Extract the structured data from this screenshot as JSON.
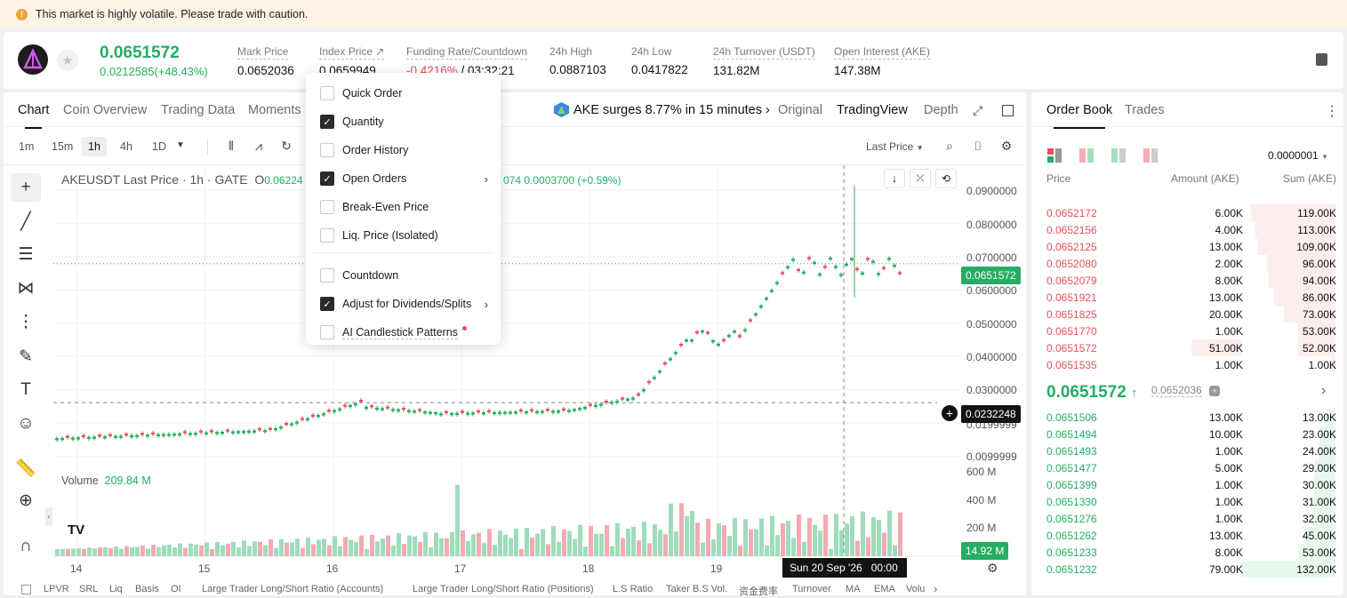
{
  "warning": "This market is highly volatile. Please trade with caution.",
  "header": {
    "last_price": "0.0651572",
    "change": "0.0212585(+48.43%)",
    "stats": [
      {
        "label": "Mark Price",
        "value": "0.0652036"
      },
      {
        "label": "Index Price ↗",
        "value": "0.0659949"
      },
      {
        "label": "Funding Rate/Countdown",
        "value_red": "-0.4216%",
        "value_rest": " / 03:32:21"
      },
      {
        "label": "24h High",
        "value": "0.0887103"
      },
      {
        "label": "24h Low",
        "value": "0.0417822"
      },
      {
        "label": "24h Turnover (USDT)",
        "value": "131.82M"
      },
      {
        "label": "Open Interest (AKE)",
        "value": "147.38M"
      }
    ]
  },
  "chart_tabs": [
    "Chart",
    "Coin Overview",
    "Trading Data",
    "Moments"
  ],
  "news": "AKE surges 8.77% in 15 minutes",
  "view_tabs": [
    "Original",
    "TradingView",
    "Depth"
  ],
  "timeframes": [
    "1m",
    "15m",
    "1h",
    "4h",
    "1D"
  ],
  "price_type": "Last Price",
  "legend": {
    "symbol": "AKEUSDT Last Price · 1h · GATE",
    "o": "O",
    "o_val": "0.06224",
    "tail": "074",
    "chg": "0.0003700 (+0.59%)"
  },
  "y_ticks": [
    "0.0900000",
    "0.0800000",
    "0.0700000",
    "0.0600000",
    "0.0500000",
    "0.0400000",
    "0.0300000",
    "0.0199999",
    "0.0099999"
  ],
  "current_price_tag": "0.0651572",
  "crosshair_price_tag": "0.0232248",
  "volume": {
    "label": "Volume",
    "value": "209.84 M",
    "ticks": [
      "600 M",
      "400 M",
      "200 M"
    ],
    "tag": "14.92 M"
  },
  "x_ticks": [
    "14",
    "15",
    "16",
    "17",
    "18",
    "19"
  ],
  "crosshair_time": "Sun 20 Sep '26",
  "crosshair_hour": "00:00",
  "menu": [
    {
      "label": "Quick Order",
      "checked": false,
      "arrow": false
    },
    {
      "label": "Quantity",
      "checked": true,
      "arrow": false
    },
    {
      "label": "Order History",
      "checked": false,
      "arrow": false
    },
    {
      "label": "Open Orders",
      "checked": true,
      "arrow": true
    },
    {
      "label": "Break-Even Price",
      "checked": false,
      "arrow": false
    },
    {
      "label": "Liq. Price (Isolated)",
      "checked": false,
      "arrow": false
    },
    {
      "label": "Countdown",
      "checked": false,
      "arrow": false
    },
    {
      "label": "Adjust for Dividends/Splits",
      "checked": true,
      "arrow": true
    },
    {
      "label": "AI Candlestick Patterns",
      "checked": false,
      "arrow": false
    }
  ],
  "bottom_indicators": [
    "LPVR",
    "SRL",
    "Liq",
    "Basis",
    "OI",
    "Large Trader Long/Short Ratio (Accounts)",
    "Large Trader Long/Short Ratio (Positions)",
    "L.S Ratio",
    "Taker B.S Vol.",
    "资金费率",
    "Turnover",
    "MA",
    "EMA",
    "Volu"
  ],
  "orderbook": {
    "tabs": [
      "Order Book",
      "Trades"
    ],
    "precision": "0.0000001",
    "cols": [
      "Price",
      "Amount (AKE)",
      "Sum (AKE)"
    ],
    "asks": [
      [
        "0.0652172",
        "6.00K",
        "119.00K",
        0.9
      ],
      [
        "0.0652156",
        "4.00K",
        "113.00K",
        0.86
      ],
      [
        "0.0652125",
        "13.00K",
        "109.00K",
        0.83
      ],
      [
        "0.0652080",
        "2.00K",
        "96.00K",
        0.73
      ],
      [
        "0.0652079",
        "8.00K",
        "94.00K",
        0.71
      ],
      [
        "0.0651921",
        "13.00K",
        "86.00K",
        0.65
      ],
      [
        "0.0651825",
        "20.00K",
        "73.00K",
        0.55
      ],
      [
        "0.0651770",
        "1.00K",
        "53.00K",
        0.4
      ],
      [
        "0.0651572",
        "51.00K",
        "52.00K",
        0.4
      ],
      [
        "0.0651535",
        "1.00K",
        "1.00K",
        0.01
      ]
    ],
    "mid_price": "0.0651572",
    "mark": "0.0652036",
    "bids": [
      [
        "0.0651506",
        "13.00K",
        "13.00K",
        0.1
      ],
      [
        "0.0651494",
        "10.00K",
        "23.00K",
        0.17
      ],
      [
        "0.0651493",
        "1.00K",
        "24.00K",
        0.18
      ],
      [
        "0.0651477",
        "5.00K",
        "29.00K",
        0.22
      ],
      [
        "0.0651399",
        "1.00K",
        "30.00K",
        0.23
      ],
      [
        "0.0651330",
        "1.00K",
        "31.00K",
        0.23
      ],
      [
        "0.0651276",
        "1.00K",
        "32.00K",
        0.24
      ],
      [
        "0.0651262",
        "13.00K",
        "45.00K",
        0.34
      ],
      [
        "0.0651233",
        "8.00K",
        "53.00K",
        0.4
      ],
      [
        "0.0651232",
        "79.00K",
        "132.00K",
        1.0
      ]
    ]
  }
}
